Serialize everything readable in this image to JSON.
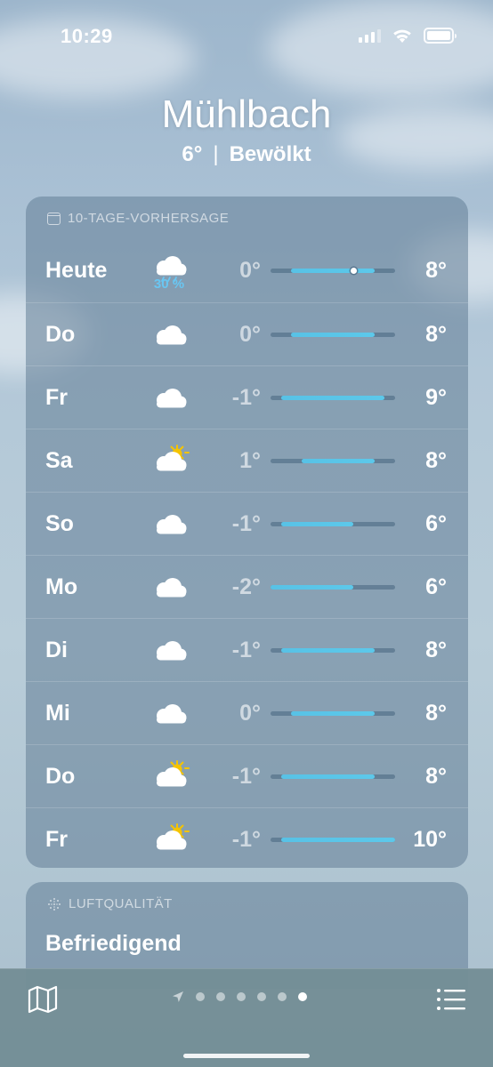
{
  "status_bar": {
    "time": "10:29",
    "battery_level": 1.0
  },
  "header": {
    "location": "Mühlbach",
    "current_temp": "6°",
    "separator": "|",
    "condition": "Bewölkt"
  },
  "forecast": {
    "title": "10-TAGE-VORHERSAGE",
    "range_min": -2,
    "range_max": 10,
    "days": [
      {
        "day": "Heute",
        "icon": "cloud-rain-icon",
        "precip": "30 %",
        "low": "0°",
        "high": "8°",
        "low_value": 0,
        "high_value": 8,
        "current_value": 6
      },
      {
        "day": "Do",
        "icon": "cloud-icon",
        "low": "0°",
        "high": "8°",
        "low_value": 0,
        "high_value": 8
      },
      {
        "day": "Fr",
        "icon": "cloud-icon",
        "low": "-1°",
        "high": "9°",
        "low_value": -1,
        "high_value": 9
      },
      {
        "day": "Sa",
        "icon": "cloud-sun-icon",
        "low": "1°",
        "high": "8°",
        "low_value": 1,
        "high_value": 8
      },
      {
        "day": "So",
        "icon": "cloud-icon",
        "low": "-1°",
        "high": "6°",
        "low_value": -1,
        "high_value": 6
      },
      {
        "day": "Mo",
        "icon": "cloud-icon",
        "low": "-2°",
        "high": "6°",
        "low_value": -2,
        "high_value": 6
      },
      {
        "day": "Di",
        "icon": "cloud-icon",
        "low": "-1°",
        "high": "8°",
        "low_value": -1,
        "high_value": 8
      },
      {
        "day": "Mi",
        "icon": "cloud-icon",
        "low": "0°",
        "high": "8°",
        "low_value": 0,
        "high_value": 8
      },
      {
        "day": "Do",
        "icon": "cloud-sun-icon",
        "low": "-1°",
        "high": "8°",
        "low_value": -1,
        "high_value": 8
      },
      {
        "day": "Fr",
        "icon": "cloud-sun-icon",
        "low": "-1°",
        "high": "10°",
        "low_value": -1,
        "high_value": 10
      }
    ]
  },
  "air_quality": {
    "title": "LUFTQUALITÄT",
    "value": "Befriedigend"
  },
  "bottom_bar": {
    "page_count": 6,
    "active_page": 5
  },
  "colors": {
    "precip": "#69c6f2",
    "temp_bar": "#5cc8ea",
    "sun": "#f5c400"
  }
}
